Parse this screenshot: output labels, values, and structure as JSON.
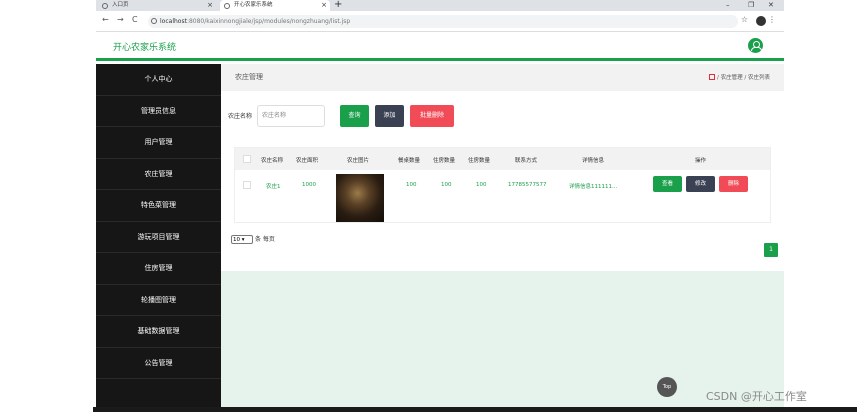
{
  "browser": {
    "tabs": [
      {
        "label": "入口页"
      },
      {
        "label": "开心农家乐系统"
      }
    ],
    "url_host": "localhost",
    "url_path": ":8080/kaixinnongjiale/jsp/modules/nongzhuang/list.jsp"
  },
  "app": {
    "title": "开心农家乐系统"
  },
  "sidebar": {
    "items": [
      {
        "label": "个人中心"
      },
      {
        "label": "管理员信息"
      },
      {
        "label": "用户管理"
      },
      {
        "label": "农庄管理"
      },
      {
        "label": "特色菜管理"
      },
      {
        "label": "游玩项目管理"
      },
      {
        "label": "住房管理"
      },
      {
        "label": "轮播图管理"
      },
      {
        "label": "基础数据管理"
      },
      {
        "label": "公告管理"
      }
    ]
  },
  "breadcrumb": {
    "title": "农庄管理",
    "path": "/ 农庄管理 / 农庄列表"
  },
  "search": {
    "label": "农庄名称",
    "placeholder": "农庄名称",
    "search_label": "查询",
    "add_label": "添加",
    "bulk_delete_label": "批量删除"
  },
  "table": {
    "headers": [
      "农庄名称",
      "农庄面积",
      "农庄图片",
      "餐桌数量",
      "住房数量",
      "住房数量",
      "联系方式",
      "详情信息",
      "操作"
    ],
    "rows": [
      {
        "name": "农庄1",
        "area": "1000",
        "tables": "100",
        "rooms1": "100",
        "rooms2": "100",
        "phone": "17785577577",
        "detail": "详情信息111111...",
        "view": "查看",
        "edit": "修改",
        "delete": "删除"
      }
    ]
  },
  "pagination": {
    "page_size": "10",
    "page_size_suffix": "条 每页",
    "current_page": "1"
  },
  "top_button": "Top",
  "watermark": "CSDN @开心工作室",
  "colors": {
    "accent": "#1aa04b",
    "sidebar_bg": "#161616",
    "add_btn": "#3a4152",
    "danger": "#f14b58",
    "main_bg": "#e6f2ec"
  }
}
